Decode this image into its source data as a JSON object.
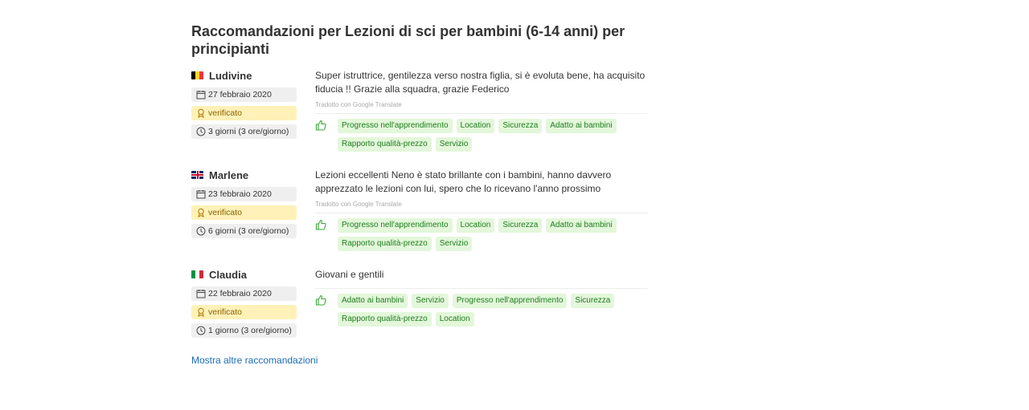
{
  "page": {
    "title": "Raccomandazioni per Lezioni di sci per bambini (6-14 anni) per principianti",
    "more_link": "Mostra altre raccomandazioni"
  },
  "reviews": [
    {
      "flag": "belgium-flag-icon",
      "name": "Ludivine",
      "date": "27 febbraio 2020",
      "verified": "verificato",
      "duration": "3 giorni (3 ore/giorno)",
      "text": "Super istruttrice, gentilezza verso nostra figlia, si è evoluta bene, ha acquisito fiducia !! Grazie alla squadra, grazie Federico",
      "translated": "Tradotto con Google Translate",
      "tags": [
        "Progresso nell'apprendimento",
        "Location",
        "Sicurezza",
        "Adatto ai bambini",
        "Rapporto qualità-prezzo",
        "Servizio"
      ]
    },
    {
      "flag": "uk-flag-icon",
      "name": "Marlene",
      "date": "23 febbraio 2020",
      "verified": "verificato",
      "duration": "6 giorni (3 ore/giorno)",
      "text": "Lezioni eccellenti Neno è stato brillante con i bambini, hanno davvero apprezzato le lezioni con lui, spero che lo ricevano l'anno prossimo",
      "translated": "Tradotto con Google Translate",
      "tags": [
        "Progresso nell'apprendimento",
        "Location",
        "Sicurezza",
        "Adatto ai bambini",
        "Rapporto qualità-prezzo",
        "Servizio"
      ]
    },
    {
      "flag": "italy-flag-icon",
      "name": "Claudia",
      "date": "22 febbraio 2020",
      "verified": "verificato",
      "duration": "1 giorno (3 ore/giorno)",
      "text": "Giovani e gentili",
      "translated": "",
      "tags": [
        "Adatto ai bambini",
        "Servizio",
        "Progresso nell'apprendimento",
        "Sicurezza",
        "Rapporto qualità-prezzo",
        "Location"
      ]
    }
  ],
  "colors": {
    "tag_bg": "#e3f7da",
    "tag_text": "#1e7d1e",
    "verified_bg": "#fff1b8",
    "link": "#1a6cb8"
  }
}
